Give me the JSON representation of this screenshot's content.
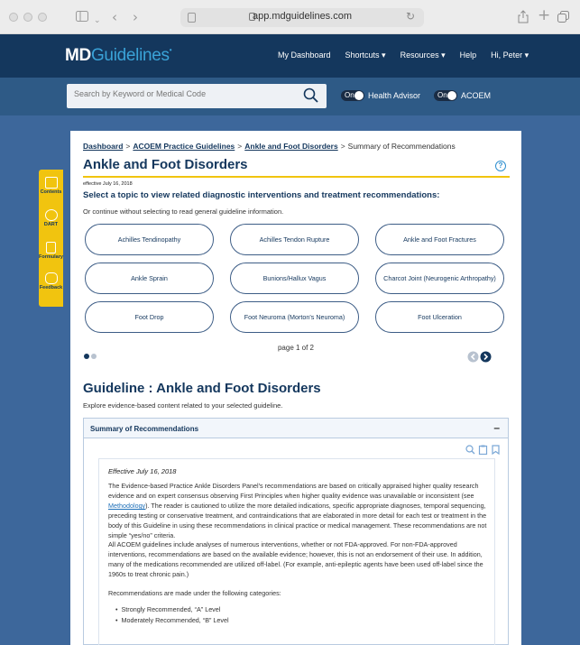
{
  "browser": {
    "url": "app.mdguidelines.com"
  },
  "header": {
    "logo_md": "MD",
    "logo_guidelines": "Guidelines",
    "nav": [
      {
        "label": "My Dashboard"
      },
      {
        "label": "Shortcuts ▾"
      },
      {
        "label": "Resources ▾"
      },
      {
        "label": "Help"
      },
      {
        "label": "Hi, Peter ▾"
      }
    ]
  },
  "search": {
    "placeholder": "Search by Keyword or Medical Code",
    "toggles": [
      {
        "state": "On",
        "label": "Health Advisor"
      },
      {
        "state": "On",
        "label": "ACOEM"
      }
    ]
  },
  "sidebar_tools": [
    {
      "label": "Contents",
      "icon": "contents-icon"
    },
    {
      "label": "DART",
      "icon": "dart-icon"
    },
    {
      "label": "Formulary",
      "icon": "formulary-icon"
    },
    {
      "label": "Feedback",
      "icon": "feedback-icon"
    }
  ],
  "breadcrumb": {
    "items": [
      "Dashboard",
      "ACOEM Practice Guidelines",
      "Ankle and Foot Disorders"
    ],
    "current": "Summary of Recommendations",
    "separator": ">"
  },
  "page": {
    "title": "Ankle and Foot Disorders",
    "help_glyph": "?",
    "effective": "effective July 16, 2018",
    "prompt": "Select a topic to view related diagnostic interventions and treatment recommendations:",
    "sub": "Or continue without selecting to read general guideline information."
  },
  "topics": [
    "Achilles Tendinopathy",
    "Achilles Tendon Rupture",
    "Ankle and Foot Fractures",
    "Ankle Sprain",
    "Bunions/Hallux Vagus",
    "Charcot Joint (Neurogenic Arthropathy)",
    "Foot Drop",
    "Foot Neuroma (Morton's Neuroma)",
    "Foot Ulceration"
  ],
  "pager": {
    "text": "page 1 of 2",
    "current_page": 1,
    "total_pages": 2
  },
  "guideline": {
    "title": "Guideline : Ankle and Foot Disorders",
    "explore": "Explore evidence-based content related to your selected guideline."
  },
  "accordion": {
    "title": "Summary of Recommendations",
    "toggle": "–",
    "effective": "Effective July 16, 2018",
    "para1_a": "The Evidence-based Practice Ankle Disorders Panel's recommendations are based on critically appraised higher quality research evidence and on expert consensus observing First Principles when higher quality evidence was unavailable or inconsistent (see ",
    "para1_link": "Methodology",
    "para1_b": "). The reader is cautioned to utilize the more detailed indications, specific appropriate diagnoses, temporal sequencing, preceding testing or conservative treatment, and contraindications that are elaborated in more detail for each test or treatment in the body of this Guideline in using these recommendations in clinical practice or medical management. These recommendations are not simple “yes/no” criteria.",
    "para2": "All ACOEM guidelines include analyses of numerous interventions, whether or not FDA-approved. For non-FDA-approved interventions, recommendations are based on the available evidence; however, this is not an endorsement of their use. In addition, many of the medications recommended are utilized off-label. (For example, anti-epileptic agents have been used off-label since the 1960s to treat chronic pain.)",
    "para3": "Recommendations are made under the following categories:",
    "bullets": [
      "Strongly Recommended, “A” Level",
      "Moderately Recommended, “B” Level"
    ]
  },
  "colors": {
    "navy": "#14375d",
    "mid_blue": "#2e5a86",
    "page_blue": "#3d679b",
    "gold": "#f1c40f",
    "link": "#1d6fb8"
  }
}
